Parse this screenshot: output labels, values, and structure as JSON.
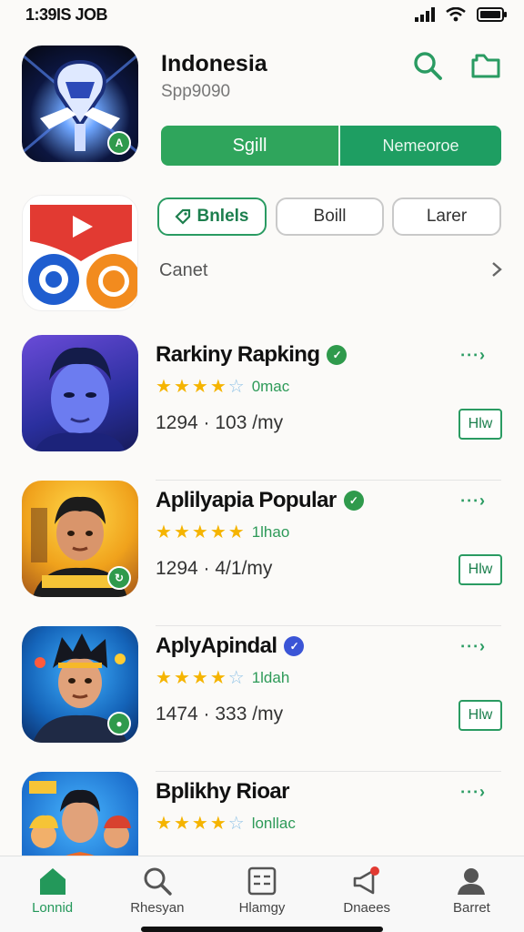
{
  "status_bar": {
    "time": "1:39IS JOB"
  },
  "hero": {
    "title": "Indonesia",
    "subtitle": "Spp9090",
    "primary_button": "Sgill",
    "secondary_button": "Nemeoroe"
  },
  "filters": {
    "chips": [
      "Bnlels",
      "Boill",
      "Larer"
    ],
    "section_label": "Canet"
  },
  "apps": [
    {
      "title": "Rarkiny Rapking",
      "rating_text": "0mac",
      "stars": 4.5,
      "price": "1294 · 103 /my",
      "action": "Hlw"
    },
    {
      "title": "Aplilyapia Popular",
      "rating_text": "1lhao",
      "stars": 5,
      "price": "1294 · 4/1/my",
      "action": "Hlw"
    },
    {
      "title": "AplyApindal",
      "rating_text": "1ldah",
      "stars": 4,
      "price": "1474 · 333 /my",
      "action": "Hlw"
    },
    {
      "title": "Bplikhy Rioar",
      "rating_text": "lonllac",
      "stars": 4,
      "price": "",
      "action": ""
    }
  ],
  "bottom_nav": [
    {
      "label": "Lonnid",
      "icon": "home-icon",
      "active": true
    },
    {
      "label": "Rhesyan",
      "icon": "search-icon",
      "active": false
    },
    {
      "label": "Hlamgy",
      "icon": "grid-icon",
      "active": false
    },
    {
      "label": "Dnaees",
      "icon": "megaphone-icon",
      "active": false
    },
    {
      "label": "Barret",
      "icon": "person-icon",
      "active": false
    }
  ],
  "colors": {
    "accent_green": "#2fa55c",
    "star": "#f5b400",
    "badge_blue": "#3b55d6"
  }
}
